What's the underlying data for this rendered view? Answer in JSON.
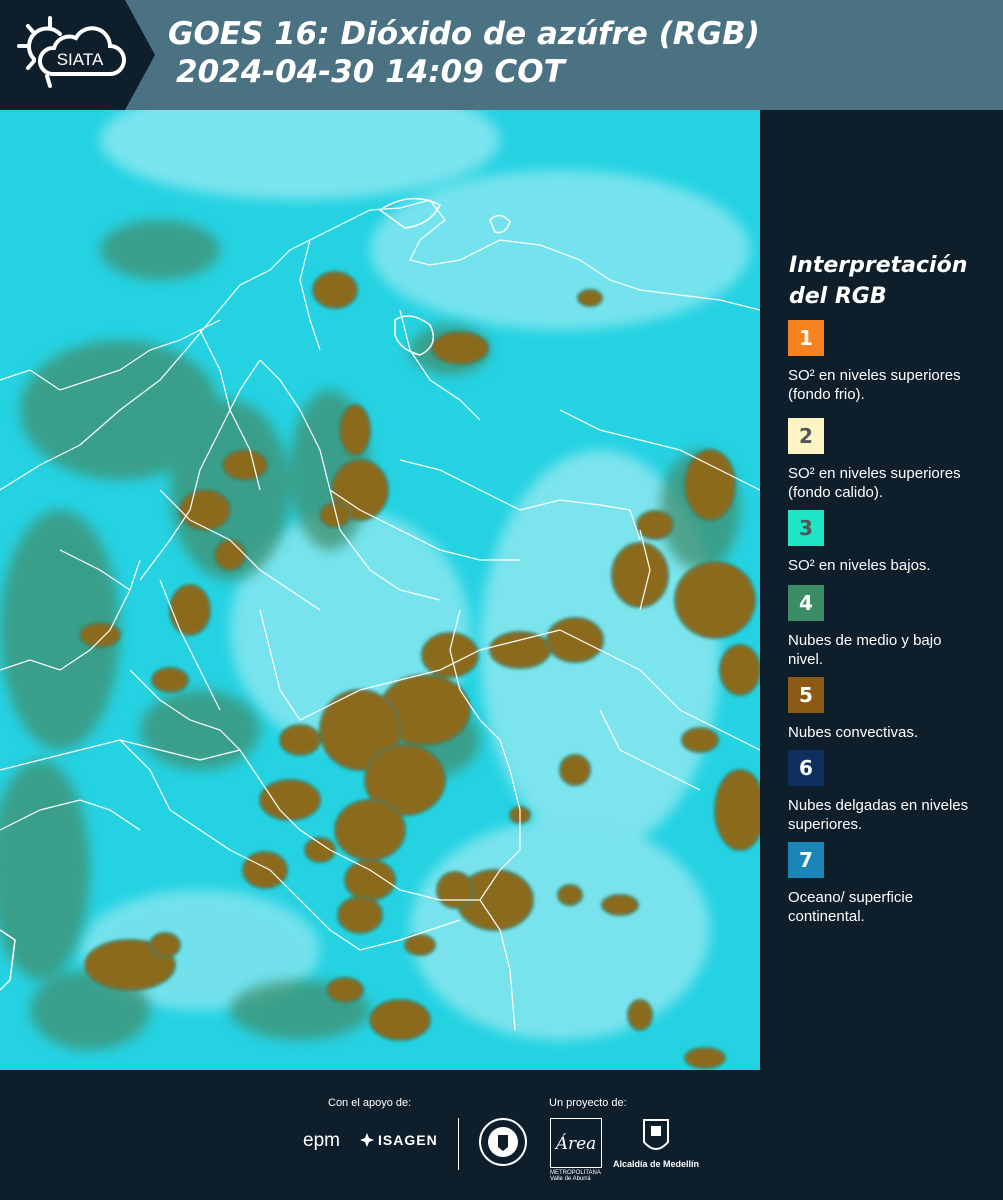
{
  "header": {
    "logo_text": "SIATA",
    "title_line1": "GOES 16: Dióxido de azúfre (RGB)",
    "title_line2": "2024-04-30 14:09 COT"
  },
  "colors": {
    "header_bg": "#4a7282",
    "panel_bg": "#0f1e2b",
    "map_surface": "#22d0e0",
    "convective_clouds": "#8b6a1d",
    "mid_low_clouds": "#3f8f6e"
  },
  "legend": {
    "title": "Interpretación del RGB",
    "items": [
      {
        "number": "1",
        "color": "#f5821f",
        "text_color": "#ffffff",
        "label": "SO² en niveles superiores (fondo frio)."
      },
      {
        "number": "2",
        "color": "#fdf4c6",
        "text_color": "#555555",
        "label": "SO² en niveles superiores (fondo calido)."
      },
      {
        "number": "3",
        "color": "#1de6c6",
        "text_color": "#555555",
        "label": "SO² en niveles bajos."
      },
      {
        "number": "4",
        "color": "#3b8d66",
        "text_color": "#ffffff",
        "label": "Nubes de medio y bajo nivel."
      },
      {
        "number": "5",
        "color": "#8c5a12",
        "text_color": "#ffffff",
        "label": "Nubes convectivas."
      },
      {
        "number": "6",
        "color": "#0d2f5e",
        "text_color": "#ffffff",
        "label": "Nubes delgadas en niveles superiores."
      },
      {
        "number": "7",
        "color": "#1a86b8",
        "text_color": "#ffffff",
        "label": "Oceano/ superficie continental."
      }
    ]
  },
  "footer": {
    "support_label": "Con el apoyo de:",
    "project_label": "Un proyecto de:",
    "sponsor_epm": "epm",
    "sponsor_isagen": "ISAGEN",
    "area_logo_text": "Área",
    "area_sub": "METROPOLITANA Valle de Aburrá",
    "alcaldia": "Alcaldía de Medellín"
  }
}
